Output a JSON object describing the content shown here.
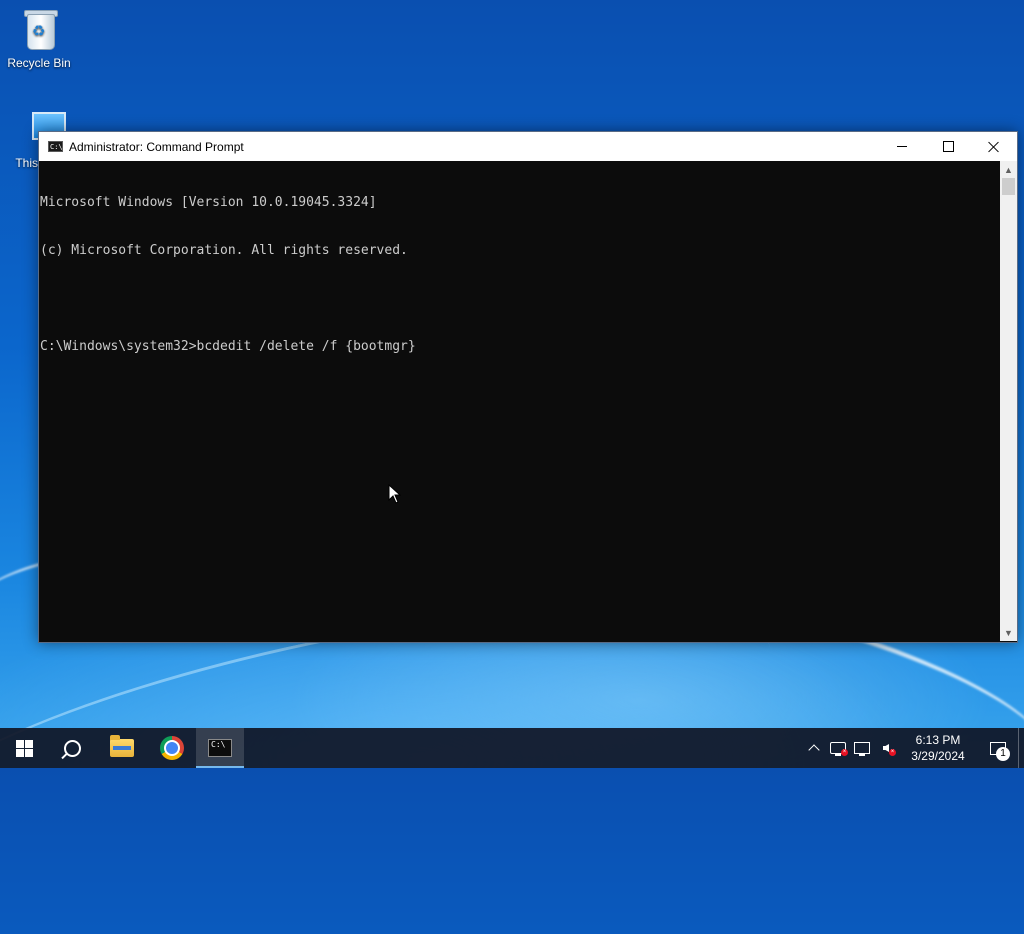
{
  "desktop": {
    "icons": [
      {
        "label": "Recycle Bin",
        "icon": "recycle-bin-icon"
      },
      {
        "label": "This",
        "icon": "this-pc-icon"
      }
    ]
  },
  "window": {
    "title": "Administrator: Command Prompt",
    "icon": "command-prompt-icon",
    "icon_text": "C:\\",
    "controls": [
      "minimize",
      "maximize",
      "close"
    ],
    "console_lines": [
      "Microsoft Windows [Version 10.0.19045.3324]",
      "(c) Microsoft Corporation. All rights reserved.",
      "",
      "C:\\Windows\\system32>bcdedit /delete /f {bootmgr}"
    ],
    "colors": {
      "background": "#0c0c0c",
      "text": "#cccccc"
    }
  },
  "taskbar": {
    "buttons": [
      {
        "name": "start",
        "icon": "windows-logo-icon"
      },
      {
        "name": "search",
        "icon": "search-icon"
      },
      {
        "name": "file-explorer",
        "icon": "folder-icon"
      },
      {
        "name": "chrome",
        "icon": "chrome-icon"
      },
      {
        "name": "command-prompt",
        "icon": "command-prompt-icon",
        "active": true
      }
    ],
    "tray": {
      "icons": [
        "chevron-up-icon",
        "action-center-warning-icon",
        "network-icon",
        "volume-muted-icon"
      ],
      "time": "6:13 PM",
      "date": "3/29/2024",
      "notification_count": "1"
    },
    "accent": "#76b9ed"
  }
}
